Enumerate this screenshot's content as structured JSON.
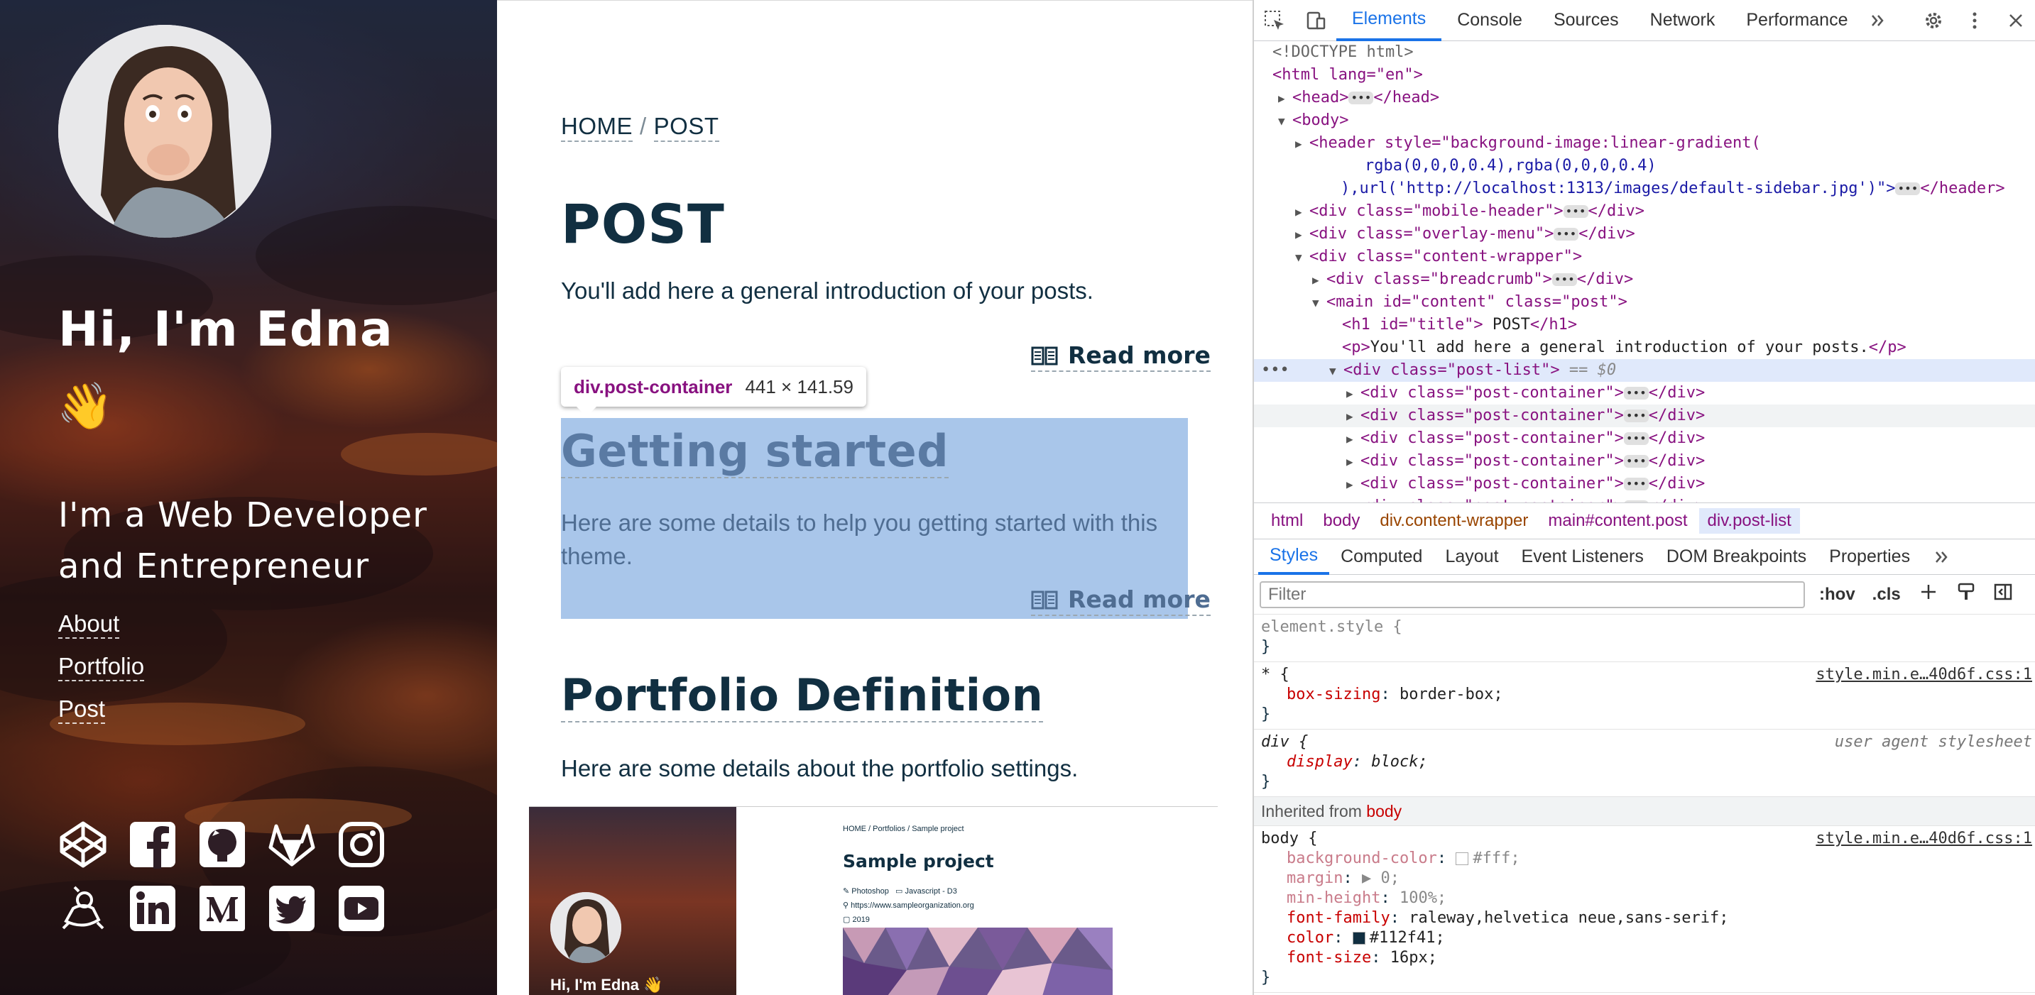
{
  "sidebar": {
    "greeting": "Hi, I'm Edna",
    "wave_emoji": "👋",
    "subtitle": "I'm a Web Developer and Entrepreneur",
    "nav": [
      "About",
      "Portfolio",
      "Post"
    ],
    "social_icons": [
      "codepen-icon",
      "facebook-icon",
      "github-icon",
      "gitlab-icon",
      "instagram-icon",
      "kaggle-icon",
      "linkedin-icon",
      "medium-icon",
      "twitter-icon",
      "youtube-icon"
    ]
  },
  "main": {
    "breadcrumb": {
      "home": "HOME",
      "separator": "/",
      "current": "POST"
    },
    "title": "POST",
    "intro": "You'll add here a general introduction of your posts.",
    "read_more": "Read more",
    "tooltip": {
      "selector": "div.post-container",
      "size": "441 × 141.59"
    },
    "posts": [
      {
        "title": "Getting started",
        "description": "Here are some details to help you getting started with this theme."
      },
      {
        "title": "Portfolio Definition",
        "description": "Here are some details about the portfolio settings."
      }
    ],
    "preview": {
      "breadcrumb": "HOME / Portfolios / Sample project",
      "title": "Sample project",
      "meta": [
        "Photoshop",
        "Javascript - D3",
        "https://www.sampleorganization.org",
        "2019"
      ],
      "side_text": "Hi, I'm Edna 👋"
    }
  },
  "devtools": {
    "tabs": [
      "Elements",
      "Console",
      "Sources",
      "Network",
      "Performance"
    ],
    "active_tab": "Elements",
    "dom": {
      "doctype": "<!DOCTYPE html>",
      "html_open": "<html lang=\"en\">",
      "head": "<head>",
      "head_close": "</head>",
      "body_open": "<body>",
      "header_1": "<header style=\"background-image:linear-gradient(",
      "header_2": "rgba(0,0,0,0.4),rgba(0,0,0,0.4)",
      "header_3": "),url('http://localhost:1313/images/default-sidebar.jpg')\">",
      "header_close": "</header>",
      "mobile_header": "<div class=\"mobile-header\">",
      "overlay_menu": "<div class=\"overlay-menu\">",
      "content_wrapper": "<div class=\"content-wrapper\">",
      "breadcrumb": "<div class=\"breadcrumb\">",
      "main": "<main id=\"content\" class=\"post\">",
      "h1_open": "<h1 id=\"title\">",
      "h1_text": " POST",
      "h1_close": "</h1>",
      "p_open": "<p>",
      "p_text": "You'll add here a general introduction of your posts.",
      "p_close": "</p>",
      "post_list": "<div class=\"post-list\">",
      "post_list_marker": "== $0",
      "post_container": "<div class=\"post-container\">",
      "div_close": "</div>",
      "ellipsis": "•••"
    },
    "breadcrumbs": [
      "html",
      "body",
      "div.content-wrapper",
      "main#content.post",
      "div.post-list"
    ],
    "style_tabs": [
      "Styles",
      "Computed",
      "Layout",
      "Event Listeners",
      "DOM Breakpoints",
      "Properties"
    ],
    "filter_placeholder": "Filter",
    "hov": ":hov",
    "cls": ".cls",
    "rules": {
      "element_style": "element.style {",
      "close": "}",
      "star_selector": "* {",
      "star_source": "style.min.e…40d6f.css:1",
      "star_decl": [
        "box-sizing",
        "border-box;"
      ],
      "div_selector": "div {",
      "div_source": "user agent stylesheet",
      "div_decl": [
        "display",
        "block;"
      ],
      "inherited_label": "Inherited from",
      "inherited_from": "body",
      "body_selector": "body {",
      "body_source": "style.min.e…40d6f.css:1",
      "body_decls": [
        [
          "background-color",
          "#fff;"
        ],
        [
          "margin",
          "0;"
        ],
        [
          "min-height",
          "100%;"
        ],
        [
          "font-family",
          "raleway,helvetica neue,sans-serif;"
        ],
        [
          "color",
          "#112f41;"
        ],
        [
          "font-size",
          "16px;"
        ]
      ]
    }
  }
}
